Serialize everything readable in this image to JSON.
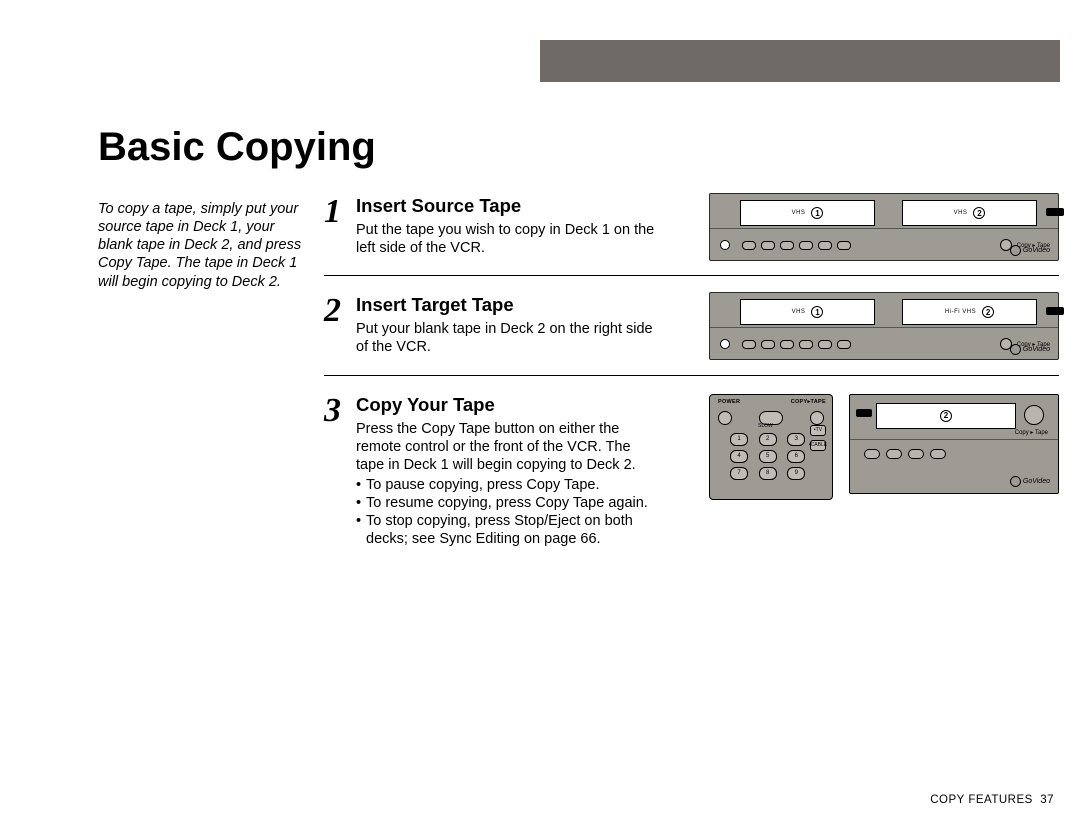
{
  "title": "Basic Copying",
  "intro": "To copy a tape, simply put your source tape in Deck 1, your blank tape in Deck 2, and press Copy Tape. The tape in Deck 1 will begin copying to Deck 2.",
  "steps": [
    {
      "num": "1",
      "title": "Insert Source Tape",
      "text": "Put the tape you wish to copy in Deck 1 on the left side of the VCR."
    },
    {
      "num": "2",
      "title": "Insert Target Tape",
      "text": "Put your blank tape in Deck 2 on the right side of the VCR."
    },
    {
      "num": "3",
      "title": "Copy Your Tape",
      "text": "Press the Copy Tape button on either the remote control or the front of the VCR. The tape in Deck 1 will begin copying to Deck 2.",
      "bullets": [
        "To pause copying, press Copy Tape.",
        "To resume copying, press Copy Tape again.",
        "To stop copying, press Stop/Eject on both decks; see Sync Editing on page 66."
      ]
    }
  ],
  "vcr": {
    "deck1": "1",
    "deck2": "2",
    "deck_label": "VHS",
    "copy_label": "Copy ▸ Tape",
    "brand": "GoVideo"
  },
  "remote": {
    "power": "POWER",
    "copy": "COPY▸TAPE",
    "slow": "SLOW",
    "tv": "•TV",
    "cable": "•CABLE"
  },
  "footer": {
    "section": "COPY FEATURES",
    "page": "37"
  }
}
